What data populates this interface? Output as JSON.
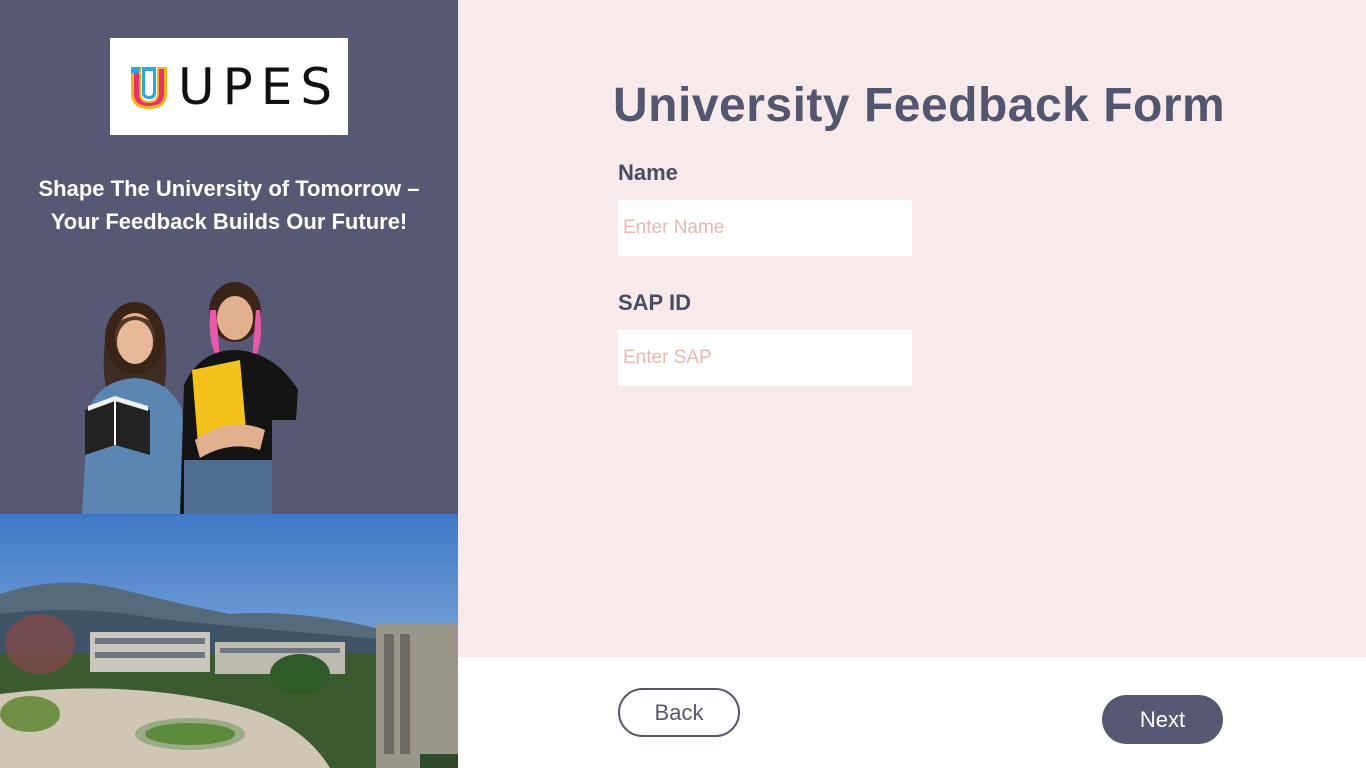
{
  "brand": {
    "logo_text": "UPES",
    "tagline_line1": "Shape The University of Tomorrow –",
    "tagline_line2": "Your Feedback Builds Our Future!",
    "panel_color": "#565874"
  },
  "form": {
    "title": "University Feedback Form",
    "name_label": "Name",
    "name_placeholder": "Enter Name",
    "sap_label": "SAP ID",
    "sap_placeholder": "Enter SAP",
    "background_color": "#f6eaea"
  },
  "footer": {
    "back_label": "Back",
    "next_label": "Next"
  }
}
